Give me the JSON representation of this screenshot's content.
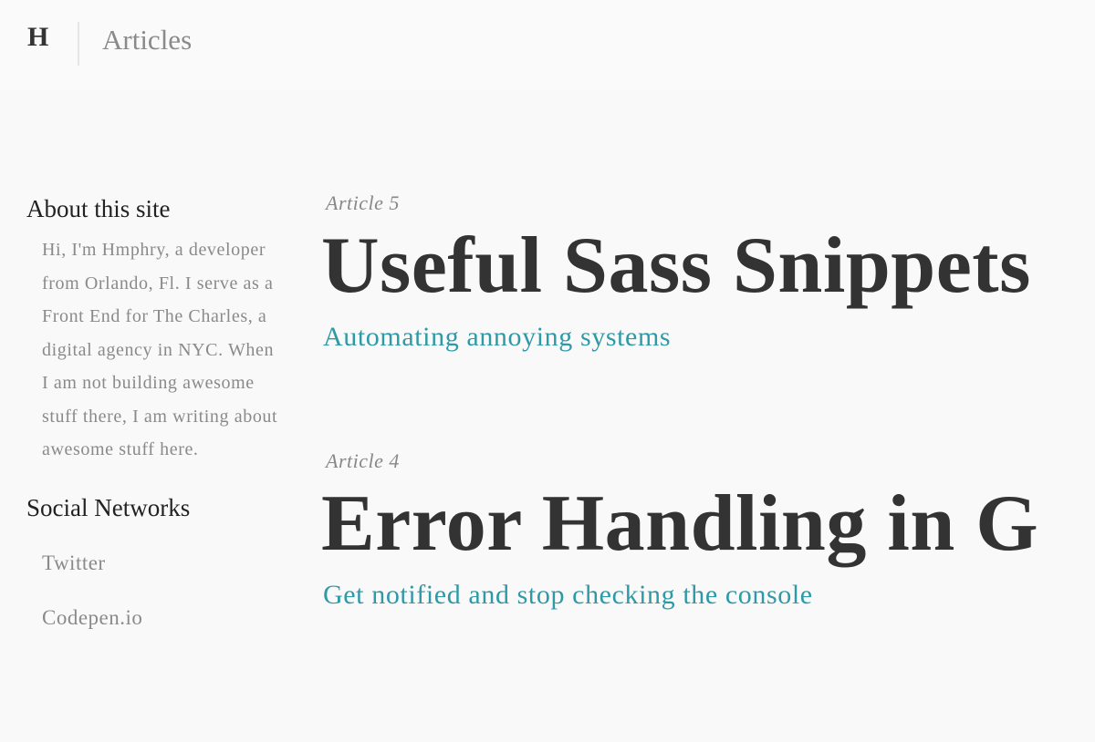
{
  "header": {
    "logo": "H",
    "title": "Articles"
  },
  "sidebar": {
    "about_heading": "About this site",
    "about_text": "Hi, I'm Hmphry, a developer from Orlando, Fl. I serve as a Front End for The Charles, a digital agency in NYC. When I am not building awesome stuff there, I am writing about awesome stuff here.",
    "social_heading": "Social Networks",
    "social_links": [
      "Twitter",
      "Codepen.io"
    ]
  },
  "articles": [
    {
      "label": "Article 5",
      "title": "Useful Sass Snippets",
      "subtitle": "Automating annoying systems"
    },
    {
      "label": "Article 4",
      "title": "Error Handling in G",
      "subtitle": "Get notified and stop checking the console"
    }
  ],
  "colors": {
    "background": "#f9f9fa",
    "heading_text": "#333333",
    "muted_text": "#8a8a8a",
    "accent_link": "#2e9aa6"
  }
}
